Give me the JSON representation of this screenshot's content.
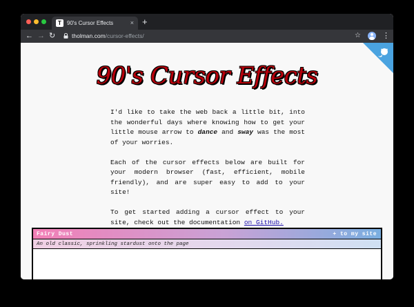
{
  "browser": {
    "tab_favicon": "T",
    "tab_title": "90's Cursor Effects",
    "tab_close": "×",
    "new_tab": "+",
    "back": "←",
    "forward": "→",
    "reload": "↻",
    "url_host": "tholman.com",
    "url_path": "/cursor-effects/",
    "star": "☆",
    "menu": "⋮"
  },
  "page": {
    "headline": "90's Cursor Effects",
    "intro_p1_a": "I'd like to take the web back a little bit, into the wonderful days where knowing how to get your little mouse arrow to ",
    "intro_p1_dance": "dance",
    "intro_p1_and": " and ",
    "intro_p1_sway": "sway",
    "intro_p1_b": " was the most of your worries.",
    "intro_p2": "Each of the cursor effects below are built for your modern browser (fast, efficient, mobile friendly), and are super easy to add to your site!",
    "intro_p3": "To get started adding a cursor effect to your site, check out the documentation ",
    "intro_p3_link": "on GitHub."
  },
  "effects": [
    {
      "title": "Fairy Dust",
      "add_label": "+ to my site",
      "description": "An old classic, sprinkling stardust onto the page"
    }
  ],
  "icons": {
    "corner": "github-octocat-icon",
    "lock": "lock-icon",
    "profile": "profile-avatar-icon"
  },
  "colors": {
    "headline": "#b8000c",
    "corner": "#4aa3e0",
    "tab_bar": "#202124",
    "toolbar": "#35363a"
  }
}
